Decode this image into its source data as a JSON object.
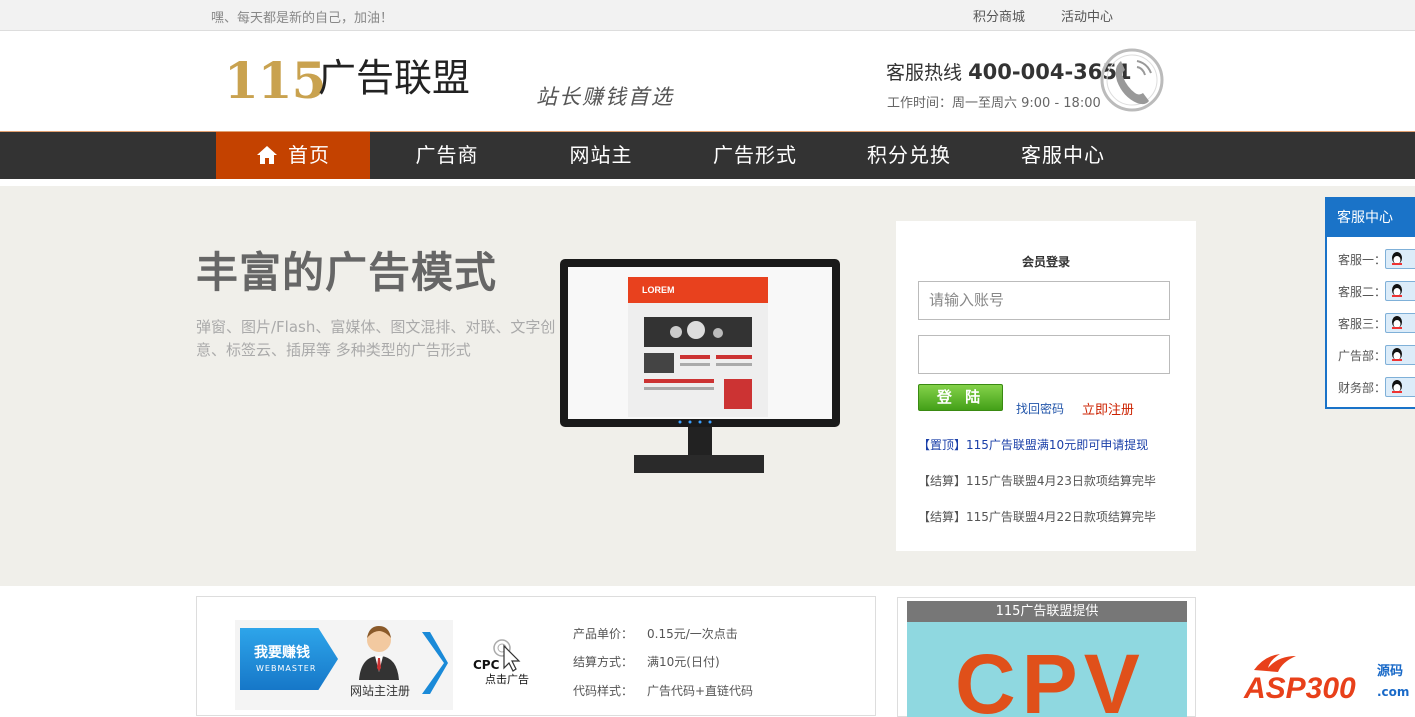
{
  "topbar": {
    "greeting": "嘿、每天都是新的自己，加油！",
    "links": [
      "积分商城",
      "活动中心"
    ]
  },
  "header": {
    "logo_number": "115",
    "logo_text": "广告联盟",
    "slogan": "站长赚钱首选",
    "hotline_label": "客服热线",
    "hotline_number": "400-004-3651",
    "work_time": "工作时间：周一至周六 9:00 - 18:00"
  },
  "nav": {
    "items": [
      "首页",
      "广告商",
      "网站主",
      "广告形式",
      "积分兑换",
      "客服中心"
    ],
    "active_index": 0
  },
  "banner": {
    "title": "丰富的广告模式",
    "desc": "弹窗、图片/Flash、富媒体、图文混排、对联、文字创意、标签云、插屏等 多种类型的广告形式",
    "screen_heading": "LOREM"
  },
  "login": {
    "title": "会员登录",
    "account_placeholder": "请输入账号",
    "password_value": "",
    "submit_label": "登 陆",
    "forgot_label": "找回密码",
    "register_label": "立即注册",
    "news": [
      {
        "tag": "【置顶】",
        "text": "115广告联盟满10元即可申请提现"
      },
      {
        "tag": "【结算】",
        "text": "115广告联盟4月23日款项结算完毕"
      },
      {
        "tag": "【结算】",
        "text": "115广告联盟4月22日款项结算完毕"
      }
    ]
  },
  "customer_service": {
    "title": "客服中心",
    "rows": [
      "客服一：",
      "客服二：",
      "客服三：",
      "广告部：",
      "财务部："
    ]
  },
  "product": {
    "earn_label": "我要赚钱",
    "earn_sub": "WEBMASTER",
    "earn_caption": "网站主注册",
    "cpc_label": "CPC",
    "cpc_sub": "点击广告",
    "specs": [
      {
        "key": "产品单价：",
        "value": "0.15元/一次点击"
      },
      {
        "key": "结算方式：",
        "value": "满10元(日付)"
      },
      {
        "key": "代码样式：",
        "value": "广告代码+直链代码"
      }
    ]
  },
  "provider": {
    "title": "115广告联盟提供",
    "big_text": "CPV"
  },
  "watermark": {
    "text": "ASP300",
    "suffix_top": "源码",
    "suffix_bottom": ".com"
  },
  "colors": {
    "nav_bg": "#333333",
    "nav_active": "#c44200",
    "banner_bg": "#f0efea",
    "cs_blue": "#1a73c8",
    "register_red": "#cc2200",
    "news_blue": "#2255aa"
  }
}
